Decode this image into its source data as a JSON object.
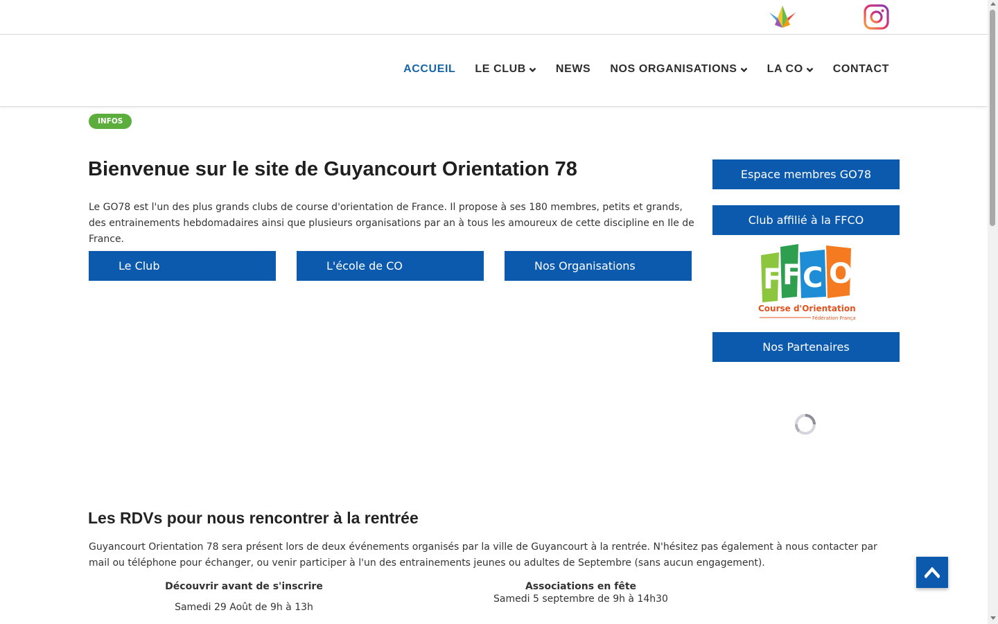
{
  "nav": {
    "items": [
      {
        "label": "ACCUEIL",
        "active": true,
        "dropdown": false
      },
      {
        "label": "LE CLUB",
        "active": false,
        "dropdown": true
      },
      {
        "label": "NEWS",
        "active": false,
        "dropdown": false
      },
      {
        "label": "NOS ORGANISATIONS",
        "active": false,
        "dropdown": true
      },
      {
        "label": "LA CO",
        "active": false,
        "dropdown": true
      },
      {
        "label": "CONTACT",
        "active": false,
        "dropdown": false
      }
    ]
  },
  "badge": "INFOS",
  "main": {
    "title": "Bienvenue sur le site de Guyancourt Orientation 78",
    "intro": "Le GO78 est l'un des plus grands clubs de course d'orientation de France. Il propose à ses 180 membres, petits et grands, des entrainements hebdomadaires ainsi que plusieurs organisations par an à tous les amoureux de cette discipline en Ile de France.",
    "buttons": [
      "Le Club",
      "L'école de CO",
      "Nos Organisations"
    ]
  },
  "sidebar": {
    "members_button": "Espace membres GO78",
    "ffco_button": "Club affilié à la FFCO",
    "partners_button": "Nos Partenaires",
    "ffco_logo": {
      "letters": [
        "F",
        "F",
        "C",
        "O"
      ],
      "caption": "Course d'Orientation",
      "subcaption": "Fédération Française"
    }
  },
  "rdv": {
    "title": "Les RDVs pour nous rencontrer à la rentrée",
    "text": "Guyancourt Orientation 78 sera présent lors de deux événements organisés par la ville de Guyancourt à la rentrée. N'hésitez pas également à nous contacter par mail ou téléphone pour échanger, ou venir participer à l'un des entrainements jeunes ou adultes de Septembre (sans aucun engagement).",
    "events": [
      {
        "name": "Découvrir avant de s'inscrire",
        "date": "Samedi 29 Août de 9h à 13h"
      },
      {
        "name": "Associations en fête",
        "date": "Samedi 5 septembre de 9h à 14h30"
      }
    ]
  },
  "colors": {
    "accent": "#0b5aad",
    "nav_active": "#1565a8",
    "badge": "#5cae3c"
  },
  "icons": [
    "crane-logo-icon",
    "instagram-icon",
    "chevron-down-icon",
    "loading-spinner-icon",
    "arrow-up-icon"
  ]
}
